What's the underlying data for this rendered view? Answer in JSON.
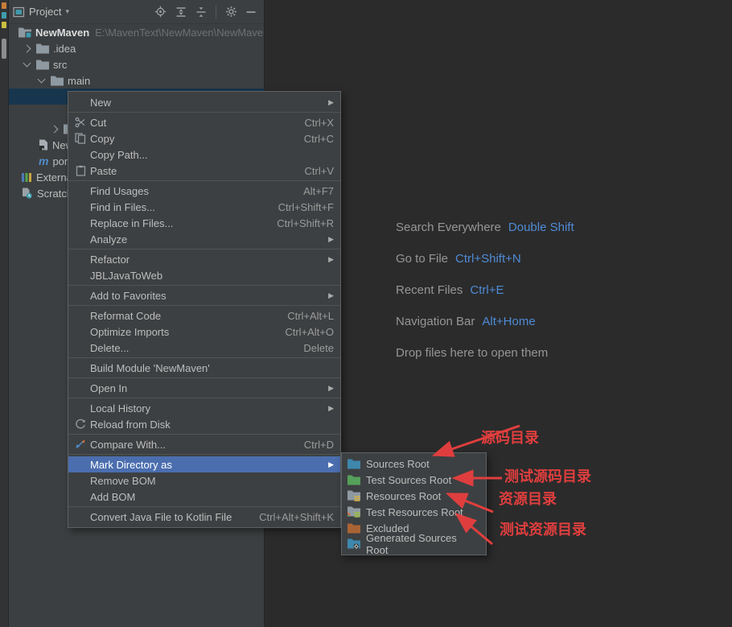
{
  "colors": {
    "editor_bg": "#2b2b2b",
    "panel_bg": "#3c3f41",
    "menu_selection_blue": "#4b6eaf",
    "tree_selection_blue": "#17364d",
    "hint_shortcut_blue": "#4e8bd6",
    "annotation_red": "#e03e3e"
  },
  "glyphs": {
    "caret_down": "▾",
    "submenu_arrow": "▶"
  },
  "icons": [
    "project-window-icon",
    "locate-icon",
    "expand-all-icon",
    "collapse-all-icon",
    "settings-gear-icon",
    "hide-icon",
    "folder-icon",
    "project-folder-icon",
    "iml-file-icon",
    "maven-icon",
    "external-libraries-icon",
    "scratches-icon",
    "cut-icon",
    "copy-icon",
    "paste-icon",
    "reload-icon",
    "compare-icon",
    "submenu-arrow-icon",
    "sources-root-folder-icon",
    "test-sources-folder-icon",
    "resources-folder-icon",
    "test-resources-folder-icon",
    "excluded-folder-icon",
    "generated-sources-folder-icon"
  ],
  "project_panel": {
    "header": {
      "title": "Project"
    },
    "tree": [
      {
        "label": "NewMaven",
        "path": "E:\\MavenText\\NewMaven\\NewMaven"
      },
      {
        "label": ".idea"
      },
      {
        "label": "src"
      },
      {
        "label": "main"
      },
      {
        "label": ""
      },
      {
        "label": ""
      },
      {
        "label": ""
      },
      {
        "label": "NewM"
      },
      {
        "label": "pom.x"
      },
      {
        "label": "External"
      },
      {
        "label": "Scratche"
      }
    ]
  },
  "context_menu": {
    "items": [
      {
        "label": "New",
        "submenu": true
      },
      {
        "label": "Cut",
        "shortcut": "Ctrl+X"
      },
      {
        "label": "Copy",
        "shortcut": "Ctrl+C"
      },
      {
        "label": "Copy Path..."
      },
      {
        "label": "Paste",
        "shortcut": "Ctrl+V"
      },
      {
        "label": "Find Usages",
        "shortcut": "Alt+F7"
      },
      {
        "label": "Find in Files...",
        "shortcut": "Ctrl+Shift+F"
      },
      {
        "label": "Replace in Files...",
        "shortcut": "Ctrl+Shift+R"
      },
      {
        "label": "Analyze",
        "submenu": true
      },
      {
        "label": "Refactor",
        "submenu": true
      },
      {
        "label": "JBLJavaToWeb"
      },
      {
        "label": "Add to Favorites",
        "submenu": true
      },
      {
        "label": "Reformat Code",
        "shortcut": "Ctrl+Alt+L"
      },
      {
        "label": "Optimize Imports",
        "shortcut": "Ctrl+Alt+O"
      },
      {
        "label": "Delete...",
        "shortcut": "Delete"
      },
      {
        "label": "Build Module 'NewMaven'"
      },
      {
        "label": "Open In",
        "submenu": true
      },
      {
        "label": "Local History",
        "submenu": true
      },
      {
        "label": "Reload from Disk"
      },
      {
        "label": "Compare With...",
        "shortcut": "Ctrl+D"
      },
      {
        "label": "Mark Directory as",
        "submenu": true,
        "selected": true
      },
      {
        "label": "Remove BOM"
      },
      {
        "label": "Add BOM"
      },
      {
        "label": "Convert Java File to Kotlin File",
        "shortcut": "Ctrl+Alt+Shift+K"
      }
    ]
  },
  "mark_directory_submenu": {
    "items": [
      {
        "label": "Sources Root"
      },
      {
        "label": "Test Sources Root"
      },
      {
        "label": "Resources Root"
      },
      {
        "label": "Test Resources Root"
      },
      {
        "label": "Excluded"
      },
      {
        "label": "Generated Sources Root"
      }
    ]
  },
  "editor_hints": {
    "lines": [
      {
        "label": "Search Everywhere",
        "shortcut": "Double Shift"
      },
      {
        "label": "Go to File",
        "shortcut": "Ctrl+Shift+N"
      },
      {
        "label": "Recent Files",
        "shortcut": "Ctrl+E"
      },
      {
        "label": "Navigation Bar",
        "shortcut": "Alt+Home"
      },
      {
        "label": "Drop files here to open them"
      }
    ]
  },
  "annotations": {
    "items": [
      {
        "text": "源码目录"
      },
      {
        "text": "测试源码目录"
      },
      {
        "text": "资源目录"
      },
      {
        "text": "测试资源目录"
      }
    ]
  }
}
